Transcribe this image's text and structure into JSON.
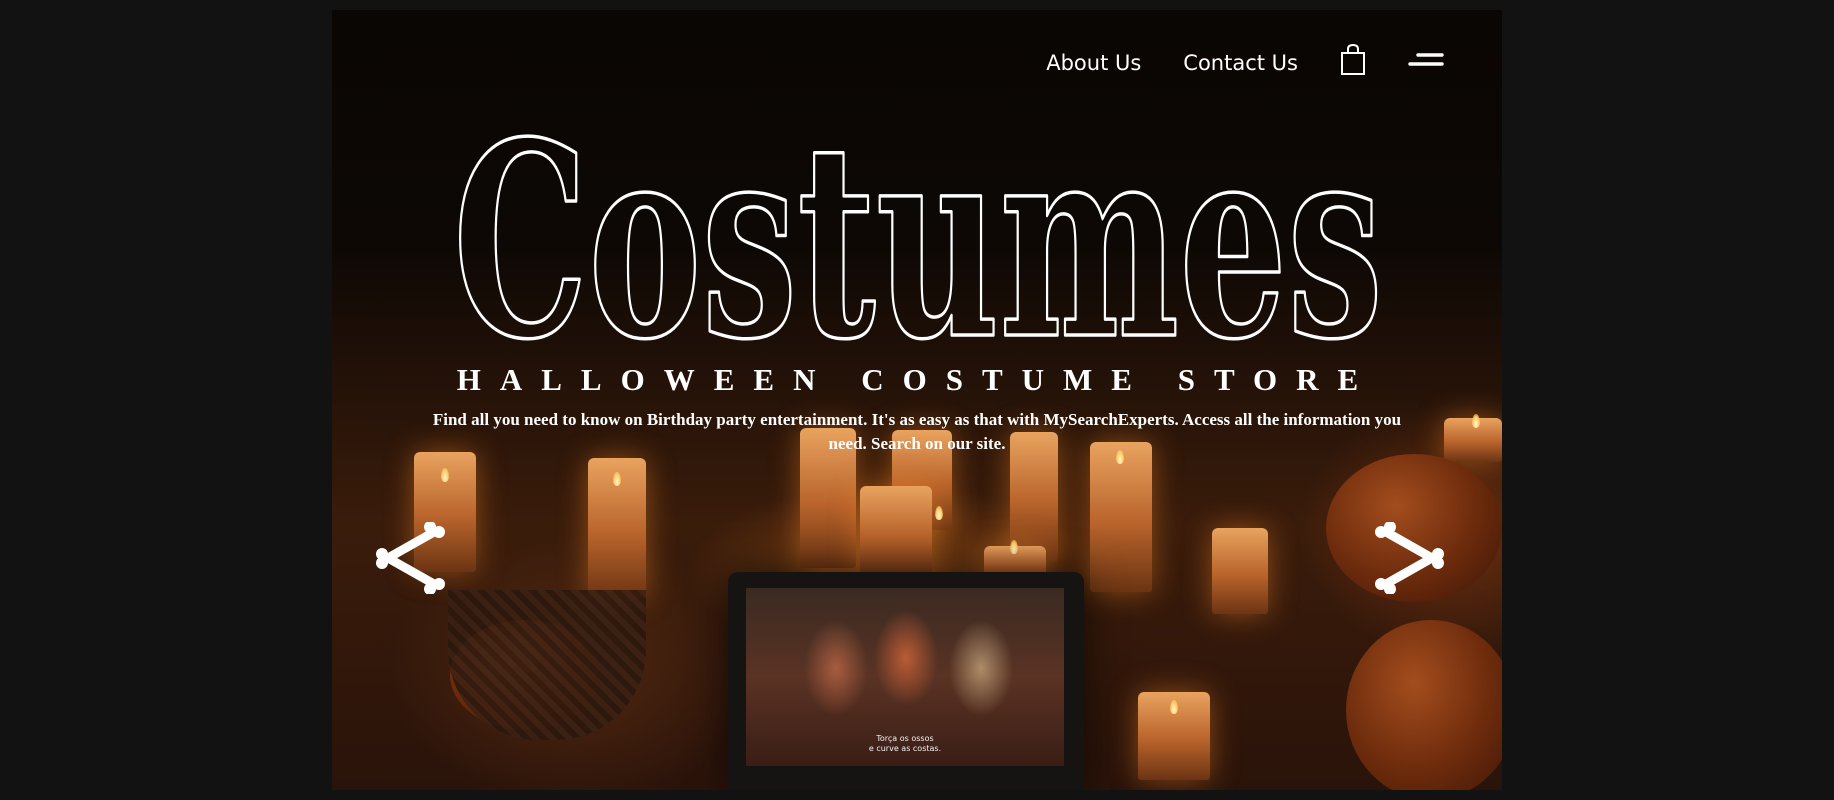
{
  "nav": {
    "about_label": "About Us",
    "contact_label": "Contact Us",
    "cart_icon": "shopping-bag-icon",
    "menu_icon": "hamburger-menu-icon"
  },
  "hero": {
    "title": "Costumes",
    "tagline": "HALLOWEEN COSTUME STORE",
    "description": "Find all you need to know on Birthday party entertainment. It's as easy as that with MySearchExperts. Access all the information you need. Search on our site.",
    "prev_icon": "bone-arrow-left-icon",
    "next_icon": "bone-arrow-right-icon",
    "video_subtitle_line1": "Torça os ossos",
    "video_subtitle_line2": "e curve as costas."
  },
  "colors": {
    "page_background": "#121212",
    "text": "#ffffff",
    "candle_glow": "#e9a35f"
  }
}
